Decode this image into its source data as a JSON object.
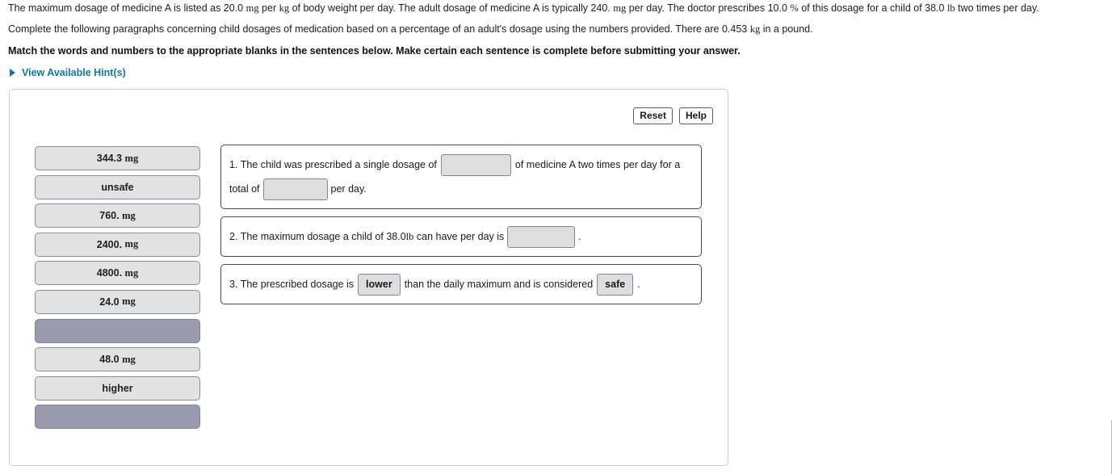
{
  "problem": {
    "line1_part1": "The maximum dosage of medicine A is listed as 20.0 ",
    "line1_unit1": "mg",
    "line1_part2": " per ",
    "line1_unit2": "kg",
    "line1_part3": " of body weight per day. The adult dosage of medicine A is typically 240. ",
    "line1_unit3": "mg",
    "line1_part4": " per day. The doctor prescribes 10.0 ",
    "line1_unit4": "%",
    "line1_part5": " of this dosage for a child of 38.0 ",
    "line1_unit5": "lb",
    "line1_part6": " two times per day.",
    "line2_part1": "Complete the following paragraphs concerning child dosages of medication based on a percentage of an adult's dosage using the numbers provided. There are 0.453 ",
    "line2_unit1": "kg",
    "line2_part2": " in a pound.",
    "instruction": "Match the words and numbers to the appropriate blanks in the sentences below. Make certain each sentence is complete before submitting your answer."
  },
  "hints": {
    "label": "View Available Hint(s)",
    "caret_icon": "triangle-right-icon",
    "color": "#0b7c9f"
  },
  "toolbar": {
    "reset_label": "Reset",
    "help_label": "Help"
  },
  "tile_bank": [
    {
      "value": "344.3",
      "unit": "mg",
      "used": false
    },
    {
      "value": "unsafe",
      "unit": "",
      "used": false
    },
    {
      "value": "760.",
      "unit": "mg",
      "used": false
    },
    {
      "value": "2400.",
      "unit": "mg",
      "used": false
    },
    {
      "value": "4800.",
      "unit": "mg",
      "used": false
    },
    {
      "value": "24.0",
      "unit": "mg",
      "used": false
    },
    {
      "value": "",
      "unit": "",
      "used": true
    },
    {
      "value": "48.0",
      "unit": "mg",
      "used": false
    },
    {
      "value": "higher",
      "unit": "",
      "used": false
    },
    {
      "value": "",
      "unit": "",
      "used": true
    }
  ],
  "sentences": {
    "s1": {
      "number": "1.",
      "text_a": "The child was prescribed a single dosage of",
      "slot1_value": "",
      "text_b": "of medicine A two times per day for a",
      "text_c": "total of",
      "slot2_value": "",
      "text_d": "per day."
    },
    "s2": {
      "number": "2.",
      "text_a": "The maximum dosage a child of 38.0",
      "unit_a": "lb",
      "text_b": "can have per day is",
      "slot1_value": "",
      "text_c": "."
    },
    "s3": {
      "number": "3.",
      "text_a": "The prescribed dosage is",
      "slot1_value": "lower",
      "text_b": "than the daily maximum and is considered",
      "slot2_value": "safe",
      "text_c": "."
    }
  },
  "colors": {
    "tile_fill": "#e2e2e2",
    "tile_used_fill": "#9a9aaf",
    "slot_fill": "#dededf",
    "link": "#0b7c9f"
  }
}
